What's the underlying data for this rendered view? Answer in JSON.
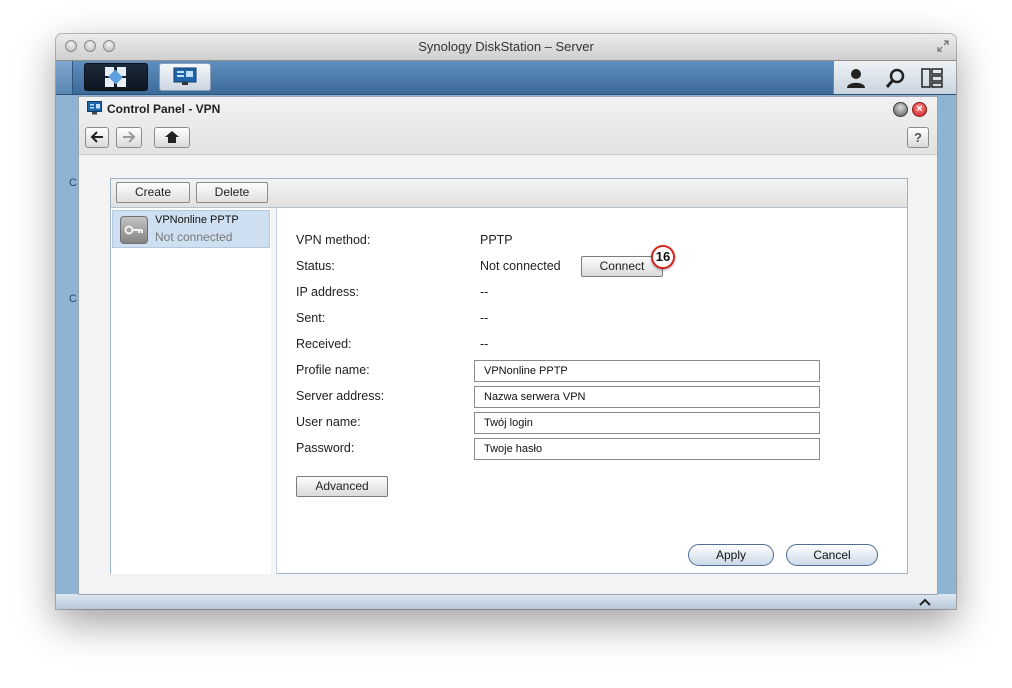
{
  "mac_window": {
    "title": "Synology DiskStation – Server"
  },
  "control_panel": {
    "title": "Control Panel - VPN",
    "help_label": "?",
    "toolbar": {
      "create_label": "Create",
      "delete_label": "Delete"
    },
    "profiles": [
      {
        "name": "VPNonline PPTP",
        "status": "Not connected"
      }
    ],
    "details": {
      "vpn_method_label": "VPN method:",
      "vpn_method_value": "PPTP",
      "status_label": "Status:",
      "status_value": "Not connected",
      "connect_label": "Connect",
      "ip_label": "IP address:",
      "ip_value": "--",
      "sent_label": "Sent:",
      "sent_value": "--",
      "received_label": "Received:",
      "received_value": "--",
      "profile_name_label": "Profile name:",
      "profile_name_value": "VPNonline PPTP",
      "server_address_label": "Server address:",
      "server_address_value": "Nazwa serwera VPN",
      "user_name_label": "User name:",
      "user_name_value": "Twój login",
      "password_label": "Password:",
      "password_value": "Twoje hasło",
      "advanced_label": "Advanced",
      "apply_label": "Apply",
      "cancel_label": "Cancel"
    },
    "callout_number": "16"
  },
  "background_letters": [
    "C",
    "C"
  ],
  "icons": {
    "main_menu": "app-grid-icon",
    "control_panel": "control-panel-icon",
    "user": "user-icon",
    "search": "search-icon",
    "widgets": "widgets-icon",
    "back": "arrow-left-icon",
    "forward": "arrow-right-icon",
    "home": "home-icon",
    "vpn": "vpn-icon",
    "close": "close-icon",
    "minimize": "minimize-icon",
    "fullscreen": "fullscreen-icon"
  },
  "colors": {
    "accent": "#4d79a8",
    "close": "#cc1f1f",
    "callout": "#d7261e",
    "selection": "#cddff0"
  }
}
